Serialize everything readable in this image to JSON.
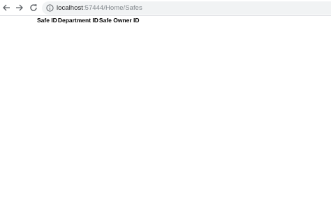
{
  "browser": {
    "url_host": "localhost",
    "url_path": ":57444/Home/Safes"
  },
  "icons": {
    "back": "back-arrow-icon",
    "forward": "forward-arrow-icon",
    "reload": "reload-icon",
    "info": "info-icon"
  },
  "colors": {
    "icon_gray": "#5f6368",
    "omnibox_bg": "#f1f3f4"
  },
  "table": {
    "headers": [
      "Safe ID",
      "Department ID",
      "Safe Owner ID"
    ],
    "rows": []
  }
}
